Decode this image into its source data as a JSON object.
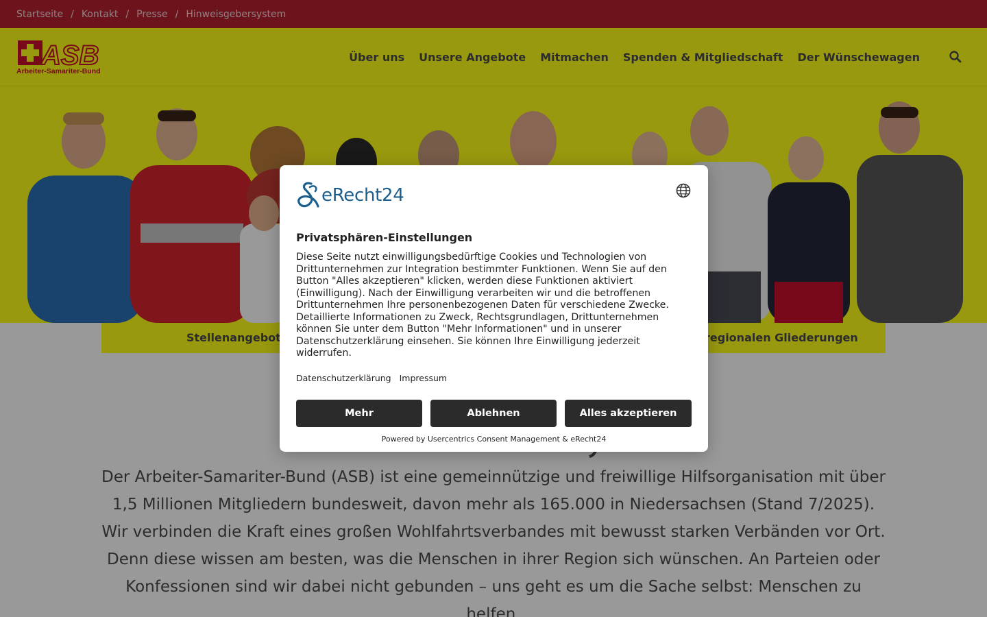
{
  "topbar": {
    "breadcrumbs": [
      "Startseite",
      "Kontakt",
      "Presse",
      "Hinweisgebersystem"
    ],
    "separator": "/"
  },
  "header": {
    "logo_text": "Arbeiter-Samariter-Bund",
    "logo_letters": "ASB",
    "nav": [
      "Über uns",
      "Unsere Angebote",
      "Mitmachen",
      "Spenden & Mitgliedschaft",
      "Der Wünschewagen"
    ],
    "search_icon": "search-icon"
  },
  "band": {
    "left_link": "Stellenangebote",
    "right_link": "regionalen Gliederungen"
  },
  "content": {
    "paragraph": "Der Arbeiter-Samariter-Bund (ASB) ist eine gemeinnützige und freiwillige Hilfsorganisation mit über 1,5 Millionen Mitgliedern bundesweit, davon mehr als 165.000 in Niedersachsen (Stand 7/2025). Wir verbinden die Kraft eines großen Wohlfahrtsverbandes mit bewusst starken Verbänden vor Ort. Denn diese wissen am besten, was die Menschen in ihrer Region sich wünschen. An Parteien oder Konfessionen sind wir dabei nicht gebunden – uns geht es um die Sache selbst: Menschen zu helfen."
  },
  "consent": {
    "brand": "eRecht24",
    "title": "Privatsphären-Einstellungen",
    "text": "Diese Seite nutzt einwilligungsbedürftige Cookies und Technologien von Drittunternehmen zur Integration bestimmter Funktionen. Wenn Sie auf den Button \"Alles akzeptieren\" klicken, werden diese Funktionen aktiviert (Einwilligung). Nach der Einwilligung verarbeiten wir und die betroffenen Drittunternehmen Ihre personenbezogenen Daten für verschiedene Zwecke. Detaillierte Informationen zu Zweck, Rechtsgrundlagen, Drittunternehmen können Sie unter dem Button \"Mehr Informationen\" und in unserer Datenschutzerklärung einsehen. Sie können Ihre Einwilligung jederzeit widerrufen.",
    "links": [
      "Datenschutzerklärung",
      "Impressum"
    ],
    "buttons": {
      "more": "Mehr",
      "decline": "Ablehnen",
      "accept": "Alles akzeptieren"
    },
    "powered_by": "Powered by Usercentrics Consent Management & eRecht24"
  },
  "colors": {
    "topbar": "#b5202e",
    "yellow": "#ffff1a",
    "brand_red": "#c8102e",
    "button_dark": "#2b2b2b",
    "erecht_blue": "#1c5f8f"
  }
}
